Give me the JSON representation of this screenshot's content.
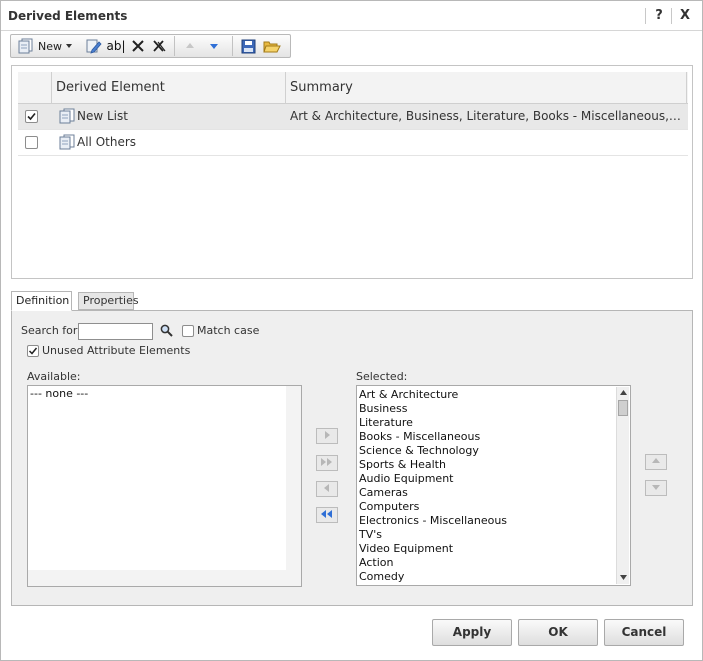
{
  "window": {
    "title": "Derived Elements",
    "help_label": "?",
    "close_label": "X"
  },
  "toolbar": {
    "new_label": "New",
    "rename_glyph": "ab|"
  },
  "grid": {
    "columns": [
      "Derived Element",
      "Summary"
    ],
    "rows": [
      {
        "name": "New List",
        "summary": "Art & Architecture, Business, Literature, Books - Miscellaneous, Sc...",
        "checked": true
      },
      {
        "name": "All Others",
        "summary": "",
        "checked": false
      }
    ]
  },
  "tabs": [
    {
      "label": "Definition",
      "active": true
    },
    {
      "label": "Properties",
      "active": false
    }
  ],
  "definition": {
    "search_label": "Search for:",
    "search_value": "",
    "match_case_label": "Match case",
    "match_case_checked": false,
    "unused_label": "Unused Attribute Elements",
    "unused_checked": true,
    "available_label": "Available:",
    "available_items": [
      "--- none ---"
    ],
    "selected_label": "Selected:",
    "selected_items": [
      "Art & Architecture",
      "Business",
      "Literature",
      "Books - Miscellaneous",
      "Science & Technology",
      "Sports & Health",
      "Audio Equipment",
      "Cameras",
      "Computers",
      "Electronics - Miscellaneous",
      "TV's",
      "Video Equipment",
      "Action",
      "Comedy"
    ]
  },
  "footer": {
    "apply_label": "Apply",
    "ok_label": "OK",
    "cancel_label": "Cancel"
  },
  "colors": {
    "accent_blue": "#2f6fd6",
    "disabled_gray": "#b7b7b7"
  }
}
